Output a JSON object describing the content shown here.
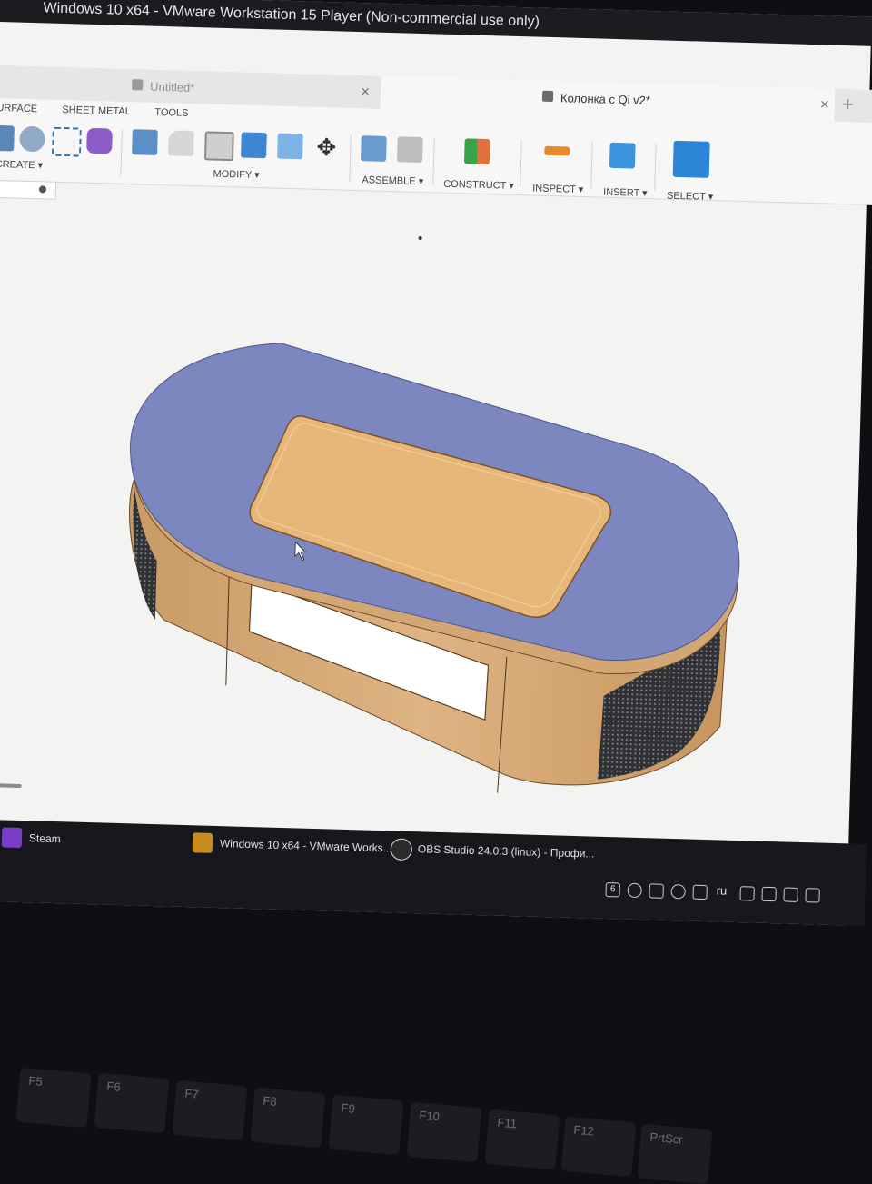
{
  "window": {
    "title": "Windows 10 x64 - VMware Workstation 15 Player (Non-commercial use only)"
  },
  "tabs": [
    {
      "label": "Untitled*",
      "active": false
    },
    {
      "label": "Колонка с  Qi v2*",
      "active": true
    }
  ],
  "workspace_tabs": [
    "URFACE",
    "SHEET METAL",
    "TOOLS"
  ],
  "toolbar_groups": {
    "create": "CREATE ▾",
    "modify": "MODIFY ▾",
    "assemble": "ASSEMBLE ▾",
    "construct": "CONSTRUCT ▾",
    "inspect": "INSPECT ▾",
    "insert": "INSERT ▾",
    "select": "SELECT ▾"
  },
  "icons": {
    "toolbar": [
      "box-icon",
      "cylinder-icon",
      "sketch-icon",
      "form-icon",
      "press-pull-icon",
      "fillet-icon",
      "shell-icon",
      "combine-icon",
      "split-icon",
      "move-icon",
      "new-component-icon",
      "joint-icon",
      "plane-icon",
      "measure-icon",
      "insert-image-icon",
      "select-icon"
    ],
    "tab": "document-cube-icon"
  },
  "taskbar": {
    "items": [
      {
        "label": "Steam",
        "icon": "steam-icon"
      },
      {
        "label": "Windows 10 x64 - VMware Works...",
        "icon": "vmware-icon",
        "active": true
      },
      {
        "label": "OBS Studio 24.0.3 (linux) - Профи...",
        "icon": "obs-icon"
      }
    ],
    "tray": {
      "language": "ru",
      "badge": "6"
    }
  },
  "keyboard": {
    "keys": [
      "F5",
      "F6",
      "F7",
      "F8",
      "F9",
      "F10",
      "F11",
      "F12",
      "PrtScr"
    ]
  },
  "colors": {
    "lid": "#7c86bf",
    "inner_panel": "#e6b778",
    "wood": "#d7ac78",
    "mesh": "#3a3c40",
    "select_blue": "#2b86d8"
  }
}
